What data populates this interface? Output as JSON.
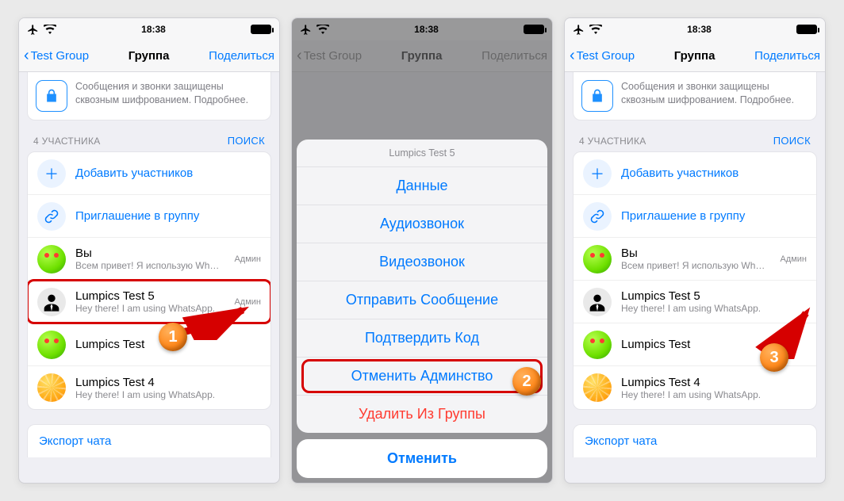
{
  "status": {
    "time": "18:38"
  },
  "nav": {
    "back": "Test Group",
    "title": "Группа",
    "share": "Поделиться"
  },
  "encryption": "Сообщения и звонки защищены сквозным шифрованием. Подробнее.",
  "participants_header": "4 УЧАСТНИКА",
  "search": "ПОИСК",
  "actions": {
    "add": "Добавить участников",
    "invite": "Приглашение в группу"
  },
  "members1": [
    {
      "name": "Вы",
      "sub": "Всем привет! Я использую Wh…",
      "badge": "Админ",
      "avatar": "lime"
    },
    {
      "name": "Lumpics Test 5",
      "sub": "Hey there! I am using WhatsApp.",
      "badge": "Админ",
      "avatar": "suit"
    },
    {
      "name": "Lumpics Test",
      "sub": "",
      "badge": "",
      "avatar": "lime"
    },
    {
      "name": "Lumpics Test 4",
      "sub": "Hey there! I am using WhatsApp.",
      "badge": "",
      "avatar": "orange"
    }
  ],
  "members3": [
    {
      "name": "Вы",
      "sub": "Всем привет! Я использую Wh…",
      "badge": "Админ",
      "avatar": "lime"
    },
    {
      "name": "Lumpics Test 5",
      "sub": "Hey there! I am using WhatsApp.",
      "badge": "",
      "avatar": "suit"
    },
    {
      "name": "Lumpics Test",
      "sub": "",
      "badge": "",
      "avatar": "lime"
    },
    {
      "name": "Lumpics Test 4",
      "sub": "Hey there! I am using WhatsApp.",
      "badge": "",
      "avatar": "orange"
    }
  ],
  "export": "Экспорт чата",
  "sheet": {
    "title": "Lumpics Test 5",
    "options": [
      {
        "label": "Данные",
        "kind": "normal"
      },
      {
        "label": "Аудиозвонок",
        "kind": "normal"
      },
      {
        "label": "Видеозвонок",
        "kind": "normal"
      },
      {
        "label": "Отправить Сообщение",
        "kind": "normal"
      },
      {
        "label": "Подтвердить Код",
        "kind": "normal"
      },
      {
        "label": "Отменить Админство",
        "kind": "normal"
      },
      {
        "label": "Удалить Из Группы",
        "kind": "destructive"
      }
    ],
    "cancel": "Отменить"
  },
  "steps": {
    "one": "1",
    "two": "2",
    "three": "3"
  }
}
